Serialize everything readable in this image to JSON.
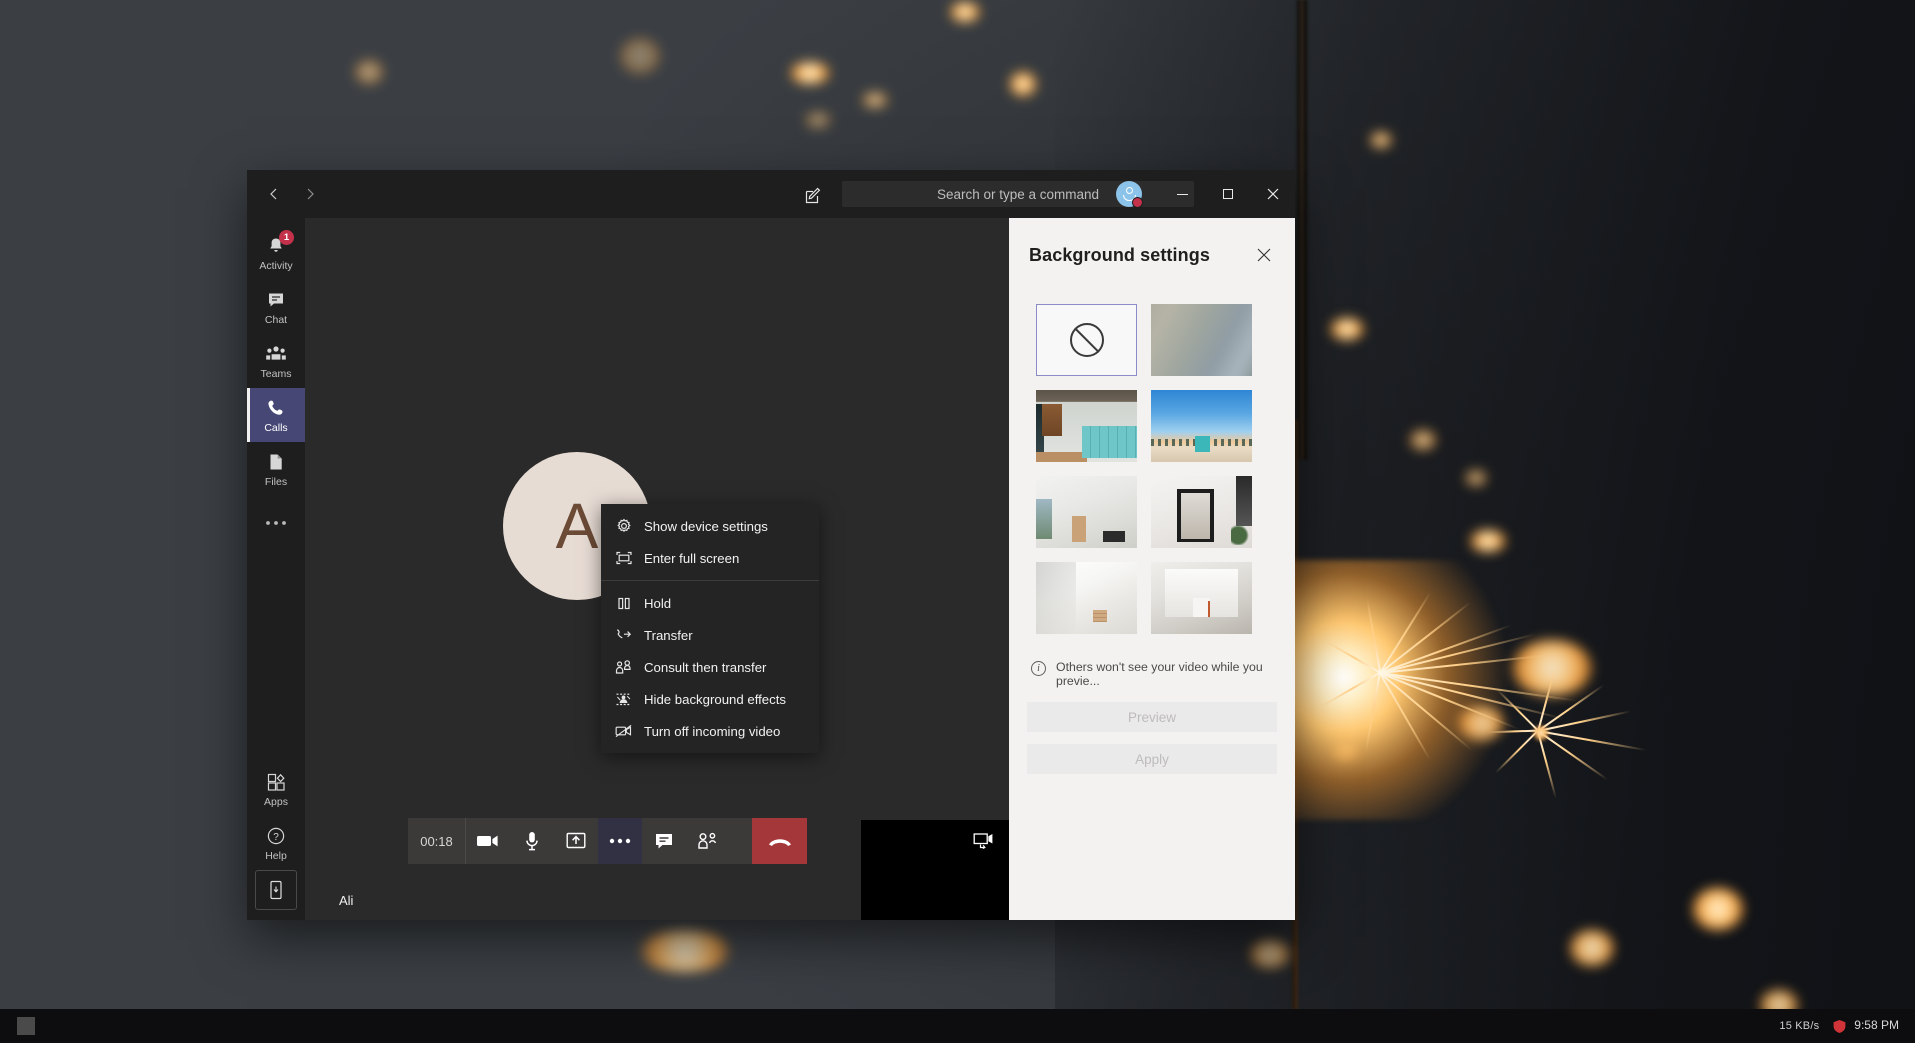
{
  "desktop": {
    "wallpaper_description": "dark grey backdrop with a burning sparkler and orange bokeh sparks on the right",
    "colors": {
      "wall_dark": "#2e3236",
      "spark_warm": "#ffc870",
      "spark_core": "#fff3d8"
    }
  },
  "taskbar": {
    "network_text": "15 KB/s",
    "clock": "9:58 PM",
    "icons": [
      "start-tile-icon",
      "network-speed-icon",
      "shield-icon",
      "clock-icon"
    ]
  },
  "teams": {
    "titlebar": {
      "back_icon": "chevron-left-icon",
      "forward_icon": "chevron-right-icon",
      "compose_icon": "compose-pencil-icon",
      "search_placeholder": "Search or type a command",
      "avatar_initial": "",
      "minimize_label": "Minimize",
      "maximize_label": "Maximize",
      "close_label": "Close"
    },
    "rail": {
      "items": [
        {
          "label": "Activity",
          "icon": "bell-icon",
          "badge": "1",
          "active": false
        },
        {
          "label": "Chat",
          "icon": "chat-bubble-icon",
          "badge": "",
          "active": false
        },
        {
          "label": "Teams",
          "icon": "people-icon",
          "badge": "",
          "active": false
        },
        {
          "label": "Calls",
          "icon": "phone-icon",
          "badge": "",
          "active": true
        },
        {
          "label": "Files",
          "icon": "file-icon",
          "badge": "",
          "active": false
        },
        {
          "label": "",
          "icon": "more-horizontal-icon",
          "badge": "",
          "active": false
        }
      ],
      "bottom_items": [
        {
          "label": "Apps",
          "icon": "apps-grid-icon"
        },
        {
          "label": "Help",
          "icon": "question-circle-icon"
        }
      ],
      "download_app_icon": "mobile-phone-icon"
    },
    "stage": {
      "participant_initial": "A",
      "self_name": "Ali",
      "self_tile_icon": "screen-share-video-icon"
    },
    "callbar": {
      "timer": "00:18",
      "buttons": [
        {
          "name": "camera-button",
          "icon": "video-camera-icon",
          "active": false
        },
        {
          "name": "microphone-button",
          "icon": "microphone-icon",
          "active": false
        },
        {
          "name": "share-screen-button",
          "icon": "share-tray-up-icon",
          "active": false
        },
        {
          "name": "more-options-button",
          "icon": "more-horizontal-icon",
          "active": true
        },
        {
          "name": "chat-button",
          "icon": "chat-bubble-icon",
          "active": false
        },
        {
          "name": "participants-button",
          "icon": "people-icon",
          "active": false
        }
      ],
      "hangup": {
        "name": "hang-up-button",
        "icon": "phone-hangup-icon",
        "color": "#a4373a"
      }
    },
    "context_menu": {
      "groups": [
        [
          {
            "label": "Show device settings",
            "icon": "gear-icon"
          },
          {
            "label": "Enter full screen",
            "icon": "fullscreen-icon"
          }
        ],
        [
          {
            "label": "Hold",
            "icon": "pause-icon"
          },
          {
            "label": "Transfer",
            "icon": "phone-arrow-icon"
          },
          {
            "label": "Consult then transfer",
            "icon": "person-add-icon"
          },
          {
            "label": "Hide background effects",
            "icon": "background-effects-icon"
          },
          {
            "label": "Turn off incoming video",
            "icon": "video-off-icon"
          }
        ]
      ]
    },
    "background_panel": {
      "title": "Background settings",
      "close_icon": "close-icon",
      "thumbnails": [
        {
          "name": "no-background",
          "type": "none",
          "selected": true
        },
        {
          "name": "blur",
          "type": "blur",
          "selected": false
        },
        {
          "name": "office-lockers",
          "type": "image",
          "selected": false
        },
        {
          "name": "beach-lifeguard-tower",
          "type": "image",
          "selected": false
        },
        {
          "name": "white-room-window",
          "type": "image",
          "selected": false
        },
        {
          "name": "room-with-mirror",
          "type": "image",
          "selected": false
        },
        {
          "name": "white-stairwell",
          "type": "image",
          "selected": false
        },
        {
          "name": "white-gallery-room",
          "type": "image",
          "selected": false
        }
      ],
      "note_icon": "info-icon",
      "note": "Others won't see your video while you previe...",
      "preview_label": "Preview",
      "apply_label": "Apply"
    }
  }
}
